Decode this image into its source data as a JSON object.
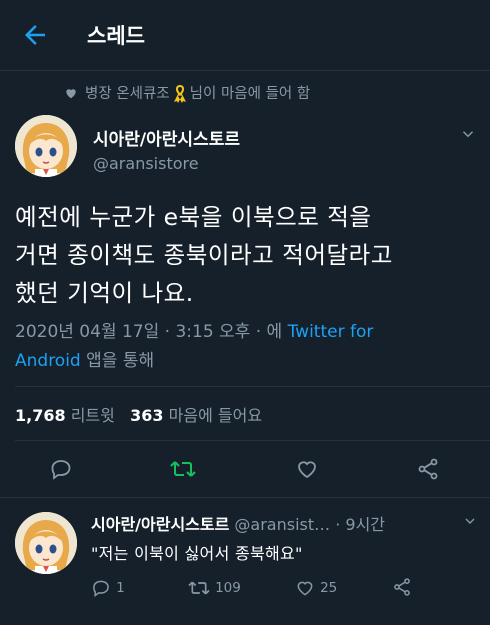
{
  "header": {
    "title": "스레드",
    "back_icon": "arrow-left-icon"
  },
  "social_context": {
    "text_before": "병장 온세큐조",
    "text_after": "님이 마음에 들어 함",
    "icons": [
      "heart-icon",
      "yellow-ribbon-icon"
    ]
  },
  "tweet": {
    "display_name": "시아란/아란시스토르",
    "handle": "@aransistore",
    "text_lines": [
      "예전에 누군가 e북을 이북으로 적을",
      "거면 종이책도 종북이라고 적어달라고",
      "했던 기억이 나요."
    ],
    "timestamp": "2020년 04월 17일 · 3:15 오후 · 에",
    "source_link_1": "Twitter for",
    "source_link_2": "Android",
    "source_suffix": "앱을 통해",
    "retweets": "1,768",
    "retweets_label": "리트윗",
    "likes": "363",
    "likes_label": "마음에 들어요",
    "menu_icon": "chevron-down-icon"
  },
  "actions": {
    "icons": [
      "reply-icon",
      "retweet-icon",
      "like-icon",
      "share-icon"
    ],
    "retweet_color": "#17bf63"
  },
  "reply": {
    "display_name": "시아란/아란시스토르",
    "handle": "@aransist…",
    "time": "· 9시간",
    "text": "\"저는 이북이 싫어서 종북해요\"",
    "reply_count": "1",
    "retweet_count": "109",
    "like_count": "25"
  },
  "colors": {
    "background": "#15202b",
    "accent": "#1da1f2",
    "secondary_text": "#8899a6",
    "divider": "#253341"
  }
}
